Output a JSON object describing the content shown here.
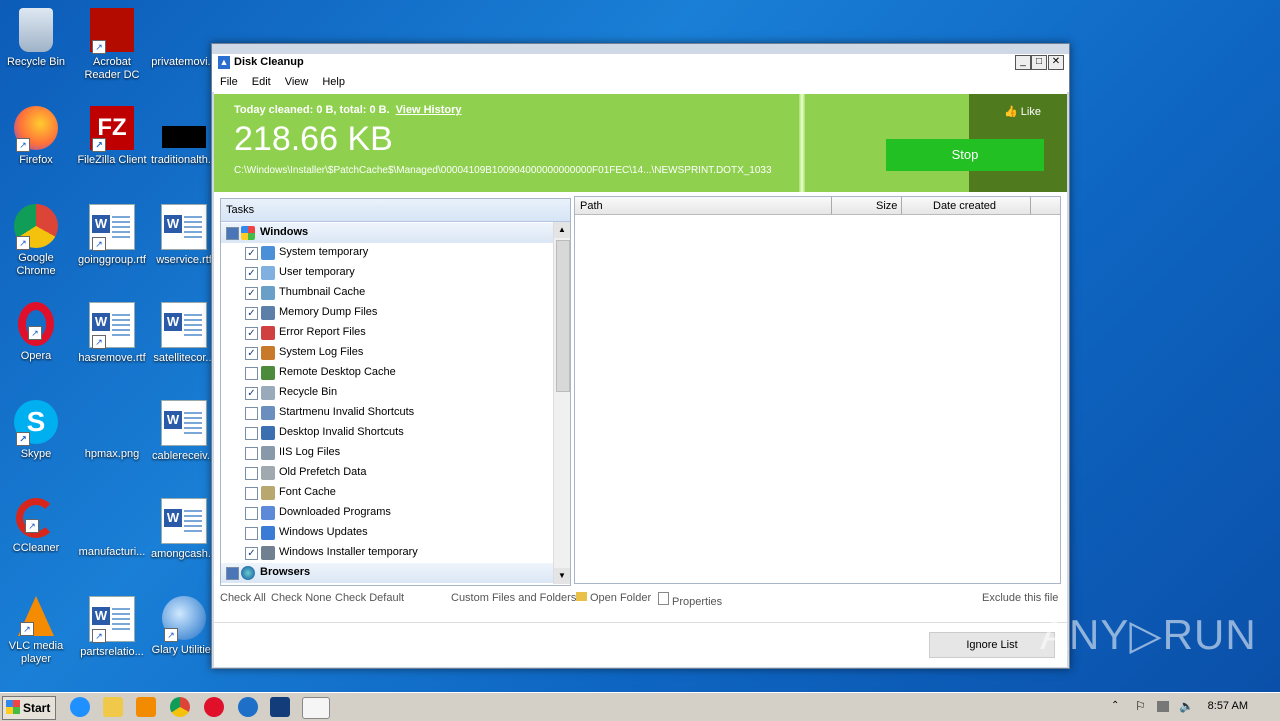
{
  "desktop": {
    "icons": [
      {
        "label": "Recycle Bin"
      },
      {
        "label": "Acrobat Reader DC"
      },
      {
        "label": "privatemovi..."
      },
      {
        "label": "Firefox"
      },
      {
        "label": "FileZilla Client"
      },
      {
        "label": "traditionalth..."
      },
      {
        "label": "Google Chrome"
      },
      {
        "label": "goinggroup.rtf"
      },
      {
        "label": "wservice.rtf"
      },
      {
        "label": "Opera"
      },
      {
        "label": "hasremove.rtf"
      },
      {
        "label": "satellitecor..."
      },
      {
        "label": "Skype"
      },
      {
        "label": "hpmax.png"
      },
      {
        "label": "cablereceiv..."
      },
      {
        "label": "CCleaner"
      },
      {
        "label": "manufacturi..."
      },
      {
        "label": "amongcash..."
      },
      {
        "label": "VLC media player"
      },
      {
        "label": "partsrelatio..."
      },
      {
        "label": "Glary Utilities"
      }
    ]
  },
  "window": {
    "title": "Disk Cleanup",
    "menu": [
      "File",
      "Edit",
      "View",
      "Help"
    ],
    "buttons": {
      "minimize": "_",
      "maximize": "□",
      "close": "✕"
    }
  },
  "banner": {
    "today_text": "Today cleaned: 0 B, total: 0 B.",
    "view_history": "View History",
    "size": "218.66 KB",
    "path": "C:\\Windows\\Installer\\$PatchCache$\\Managed\\00004109B100904000000000000F01FEC\\14...\\NEWSPRINT.DOTX_1033",
    "like": "Like",
    "stop": "Stop",
    "colors": {
      "green": "#8fd14f",
      "dark": "#4f7a1e",
      "stop": "#23c024"
    }
  },
  "tasks": {
    "header": "Tasks",
    "groups": [
      {
        "label": "Windows",
        "items": [
          {
            "label": "System temporary",
            "checked": true
          },
          {
            "label": "User temporary",
            "checked": true
          },
          {
            "label": "Thumbnail Cache",
            "checked": true
          },
          {
            "label": "Memory Dump Files",
            "checked": true
          },
          {
            "label": "Error Report Files",
            "checked": true
          },
          {
            "label": "System Log Files",
            "checked": true
          },
          {
            "label": "Remote Desktop Cache",
            "checked": false
          },
          {
            "label": "Recycle Bin",
            "checked": true
          },
          {
            "label": "Startmenu Invalid Shortcuts",
            "checked": false
          },
          {
            "label": "Desktop Invalid Shortcuts",
            "checked": false
          },
          {
            "label": "IIS Log Files",
            "checked": false
          },
          {
            "label": "Old Prefetch Data",
            "checked": false
          },
          {
            "label": "Font Cache",
            "checked": false
          },
          {
            "label": "Downloaded Programs",
            "checked": false
          },
          {
            "label": "Windows Updates",
            "checked": false
          },
          {
            "label": "Windows Installer temporary",
            "checked": true
          }
        ]
      },
      {
        "label": "Browsers",
        "items": []
      }
    ]
  },
  "files": {
    "columns": [
      "Path",
      "Size",
      "Date created"
    ]
  },
  "actions": {
    "check_all": "Check All",
    "check_none": "Check None",
    "check_default": "Check Default",
    "custom": "Custom Files and Folders",
    "open_folder": "Open Folder",
    "properties": "Properties",
    "exclude": "Exclude this file",
    "ignore_list": "Ignore List"
  },
  "taskbar": {
    "start": "Start",
    "clock": "8:57 AM"
  },
  "watermark": "ANY▷RUN"
}
